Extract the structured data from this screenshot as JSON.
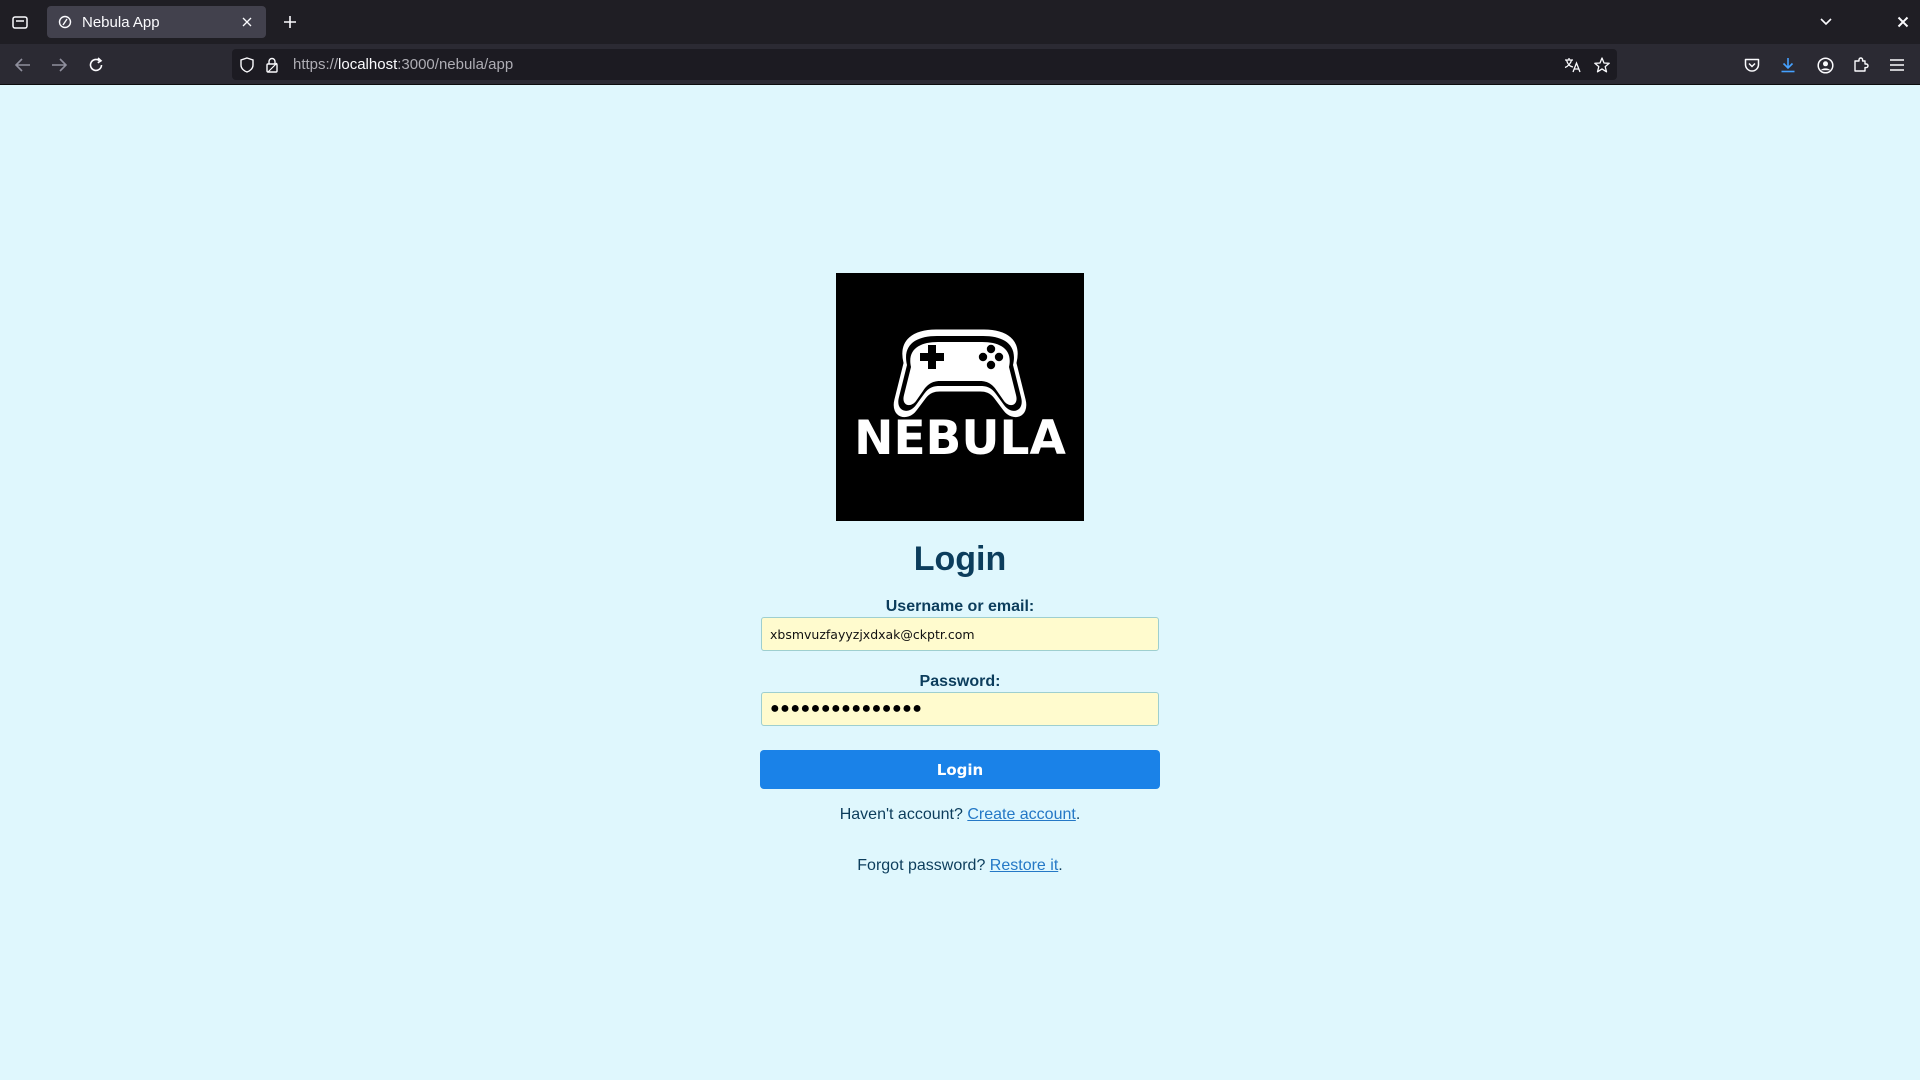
{
  "browser": {
    "tab": {
      "title": "Nebula App"
    },
    "url": {
      "scheme": "https://",
      "host": "localhost",
      "rest": ":3000/nebula/app"
    }
  },
  "icons": {
    "list_all_tabs": "list-all-tabs-icon",
    "close_tab": "close-icon",
    "new_tab": "plus-icon",
    "tab_overflow": "chevron-down-icon",
    "window_close": "close-icon",
    "back": "arrow-left-icon",
    "forward": "arrow-right-icon",
    "reload": "reload-icon",
    "shield": "shield-icon",
    "lock": "lock-icon",
    "translate": "translate-icon",
    "bookmark": "star-icon",
    "pocket": "pocket-icon",
    "downloads": "download-icon",
    "account": "account-icon",
    "extensions": "puzzle-icon",
    "menu": "hamburger-menu-icon"
  },
  "colors": {
    "page_background": "#dff7fd",
    "heading": "#0c3d5c",
    "input_background": "#fffbce",
    "button": "#1a82e8",
    "link": "#2478c6"
  },
  "logo": {
    "text": "NEBULA"
  },
  "login": {
    "heading": "Login",
    "username_label": "Username or email:",
    "username_value": "xbsmvuzfayyzjxdxak@ckptr.com",
    "password_label": "Password:",
    "password_mask": "●●●●●●●●●●●●●●●",
    "button_label": "Login",
    "signup_prompt": "Haven't account?",
    "signup_link": "Create account",
    "forgot_prompt": "Forgot password?",
    "forgot_link": "Restore it",
    "period": "."
  }
}
